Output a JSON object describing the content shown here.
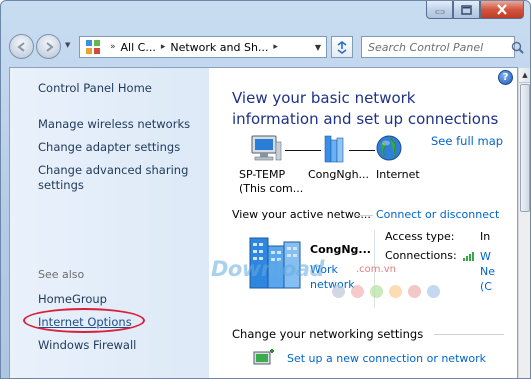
{
  "window": {
    "controls": {
      "minimize": "minimize",
      "maximize": "maximize",
      "close": "close"
    }
  },
  "navbar": {
    "breadcrumbs": [
      "All C...",
      "Network and Sh..."
    ],
    "search_placeholder": "Search Control Panel"
  },
  "sidebar": {
    "home": "Control Panel Home",
    "tasks": [
      {
        "label": "Manage wireless networks"
      },
      {
        "label": "Change adapter settings"
      },
      {
        "label": "Change advanced sharing\nsettings"
      }
    ],
    "see_also_header": "See also",
    "see_also": [
      {
        "label": "HomeGroup"
      },
      {
        "label": "Internet Options",
        "highlighted": true
      },
      {
        "label": "Windows Firewall"
      }
    ],
    "highlight_color": "#d8203a"
  },
  "main": {
    "help_symbol": "?",
    "title": "View your basic network information and set up connections",
    "see_full_map": "See full map",
    "map": {
      "nodes": [
        {
          "label": "SP-TEMP\n(This com...",
          "icon": "computer-icon"
        },
        {
          "label": "CongNgh...",
          "icon": "network-icon"
        },
        {
          "label": "Internet",
          "icon": "globe-icon"
        }
      ]
    },
    "active_networks": {
      "header": "View your active netwo...",
      "connect_link": "Connect or disconnect",
      "network_name": "CongNg...",
      "network_type": "Work\nnetwork",
      "access_type_label": "Access type:",
      "access_type_value": "In",
      "connections_label": "Connections:",
      "connections_value": "W\nNe\n(C"
    },
    "change_settings_header": "Change your networking settings",
    "setup_link": "Set up a new connection or network"
  },
  "watermark": {
    "text": "Download",
    "suffix": ".com.vn"
  },
  "colors": {
    "link": "#0066cc",
    "title": "#1e3287",
    "sidebar_text": "#1e395b"
  }
}
